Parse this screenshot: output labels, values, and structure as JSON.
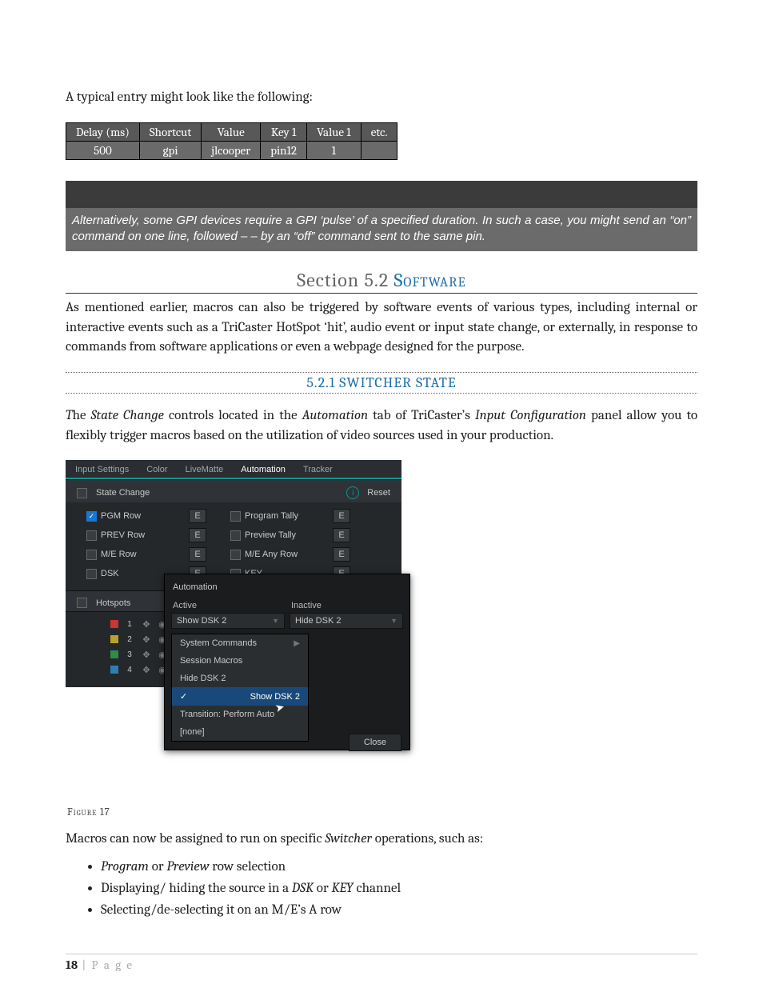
{
  "intro": "A typical entry might look like the following:",
  "entry_table": {
    "headers": [
      "Delay (ms)",
      "Shortcut",
      "Value",
      "Key 1",
      "Value 1",
      "etc."
    ],
    "row": [
      "500",
      "gpi",
      "jlcooper",
      "pin12",
      "1",
      ""
    ]
  },
  "pulse_note": "Alternatively, some GPI devices require a GPI ‘pulse’ of a specified duration.  In such a case, you might send an “on” command on one line, followed –                                 – by an “off” command sent to the same pin.",
  "section": {
    "number": "Section 5.2",
    "title": "Software"
  },
  "section_para": "As mentioned earlier, macros can also be triggered by software events of various types, including internal or interactive events such as a TriCaster HotSpot ‘hit’, audio event or input state change, or externally, in response to commands from software applications or even a webpage designed for the purpose.",
  "subsection": "5.2.1 SWITCHER STATE",
  "state_para_a": "T",
  "state_para_b": "he ",
  "state_para_c": "State Change",
  "state_para_d": " controls located in the ",
  "state_para_e": "Automation",
  "state_para_f": " tab of TriCaster’s ",
  "state_para_g": "Input Configuration",
  "state_para_h": " panel allow you to flexibly trigger macros based on the utilization of video sources used in your production.",
  "mock": {
    "tabs": [
      "Input Settings",
      "Color",
      "LiveMatte",
      "Automation",
      "Tracker"
    ],
    "active_tab": "Automation",
    "state_change": "State Change",
    "reset": "Reset",
    "rows_left": [
      "PGM Row",
      "PREV Row",
      "M/E Row",
      "DSK"
    ],
    "rows_right": [
      "Program Tally",
      "Preview Tally",
      "M/E Any Row",
      "KEY"
    ],
    "e": "E",
    "hotspots": "Hotspots",
    "hotspot_nums": [
      "1",
      "2",
      "3",
      "4"
    ],
    "automation": "Automation",
    "active": "Active",
    "inactive": "Inactive",
    "dd_active": "Show DSK 2",
    "dd_inactive": "Hide DSK 2",
    "menu": [
      "System Commands",
      "Session Macros",
      "Hide DSK 2",
      "Show DSK 2",
      "Transition: Perform Auto",
      "[none]"
    ],
    "menu_selected": "Show DSK 2",
    "close": "Close"
  },
  "figure": "Figure 17",
  "ops_intro_a": "Macros can now be assigned to run on specific ",
  "ops_intro_b": "Switcher",
  "ops_intro_c": " operations, such as:",
  "ops": [
    {
      "i1": "Program",
      "mid": " or ",
      "i2": "Preview",
      "tail": " row selection"
    },
    {
      "plain_a": "Displaying/ hiding the source in a ",
      "i1": "DSK",
      "mid": " or ",
      "i2": "KEY",
      "tail": " channel"
    },
    {
      "plain_a": "Selecting/de-selecting it on an M/E’s A row"
    }
  ],
  "page_number": "18",
  "page_label": " | P a g e"
}
